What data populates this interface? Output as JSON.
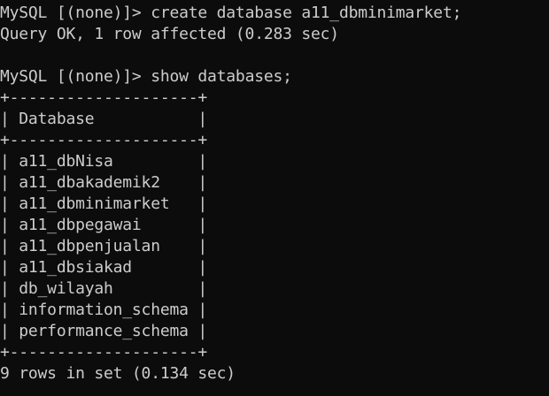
{
  "terminal": {
    "background": "#0c0c0c",
    "foreground": "#cccccc",
    "lines": [
      {
        "kind": "command",
        "prompt": "MySQL [(none)]> ",
        "text": "create database a11_dbminimarket;"
      },
      {
        "kind": "output",
        "text": "Query OK, 1 row affected (0.283 sec)"
      },
      {
        "kind": "blank",
        "text": ""
      },
      {
        "kind": "command",
        "prompt": "MySQL [(none)]> ",
        "text": "show databases;"
      },
      {
        "kind": "table-border",
        "text": "+--------------------+"
      },
      {
        "kind": "table-header",
        "text": "| Database           |"
      },
      {
        "kind": "table-border",
        "text": "+--------------------+"
      },
      {
        "kind": "table-row",
        "text": "| a11_dbNisa         |"
      },
      {
        "kind": "table-row",
        "text": "| a11_dbakademik2    |"
      },
      {
        "kind": "table-row",
        "text": "| a11_dbminimarket   |"
      },
      {
        "kind": "table-row",
        "text": "| a11_dbpegawai      |"
      },
      {
        "kind": "table-row",
        "text": "| a11_dbpenjualan    |"
      },
      {
        "kind": "table-row",
        "text": "| a11_dbsiakad       |"
      },
      {
        "kind": "table-row",
        "text": "| db_wilayah         |"
      },
      {
        "kind": "table-row",
        "text": "| information_schema |"
      },
      {
        "kind": "table-row",
        "text": "| performance_schema |"
      },
      {
        "kind": "table-border",
        "text": "+--------------------+"
      },
      {
        "kind": "output",
        "text": "9 rows in set (0.134 sec)"
      }
    ]
  }
}
